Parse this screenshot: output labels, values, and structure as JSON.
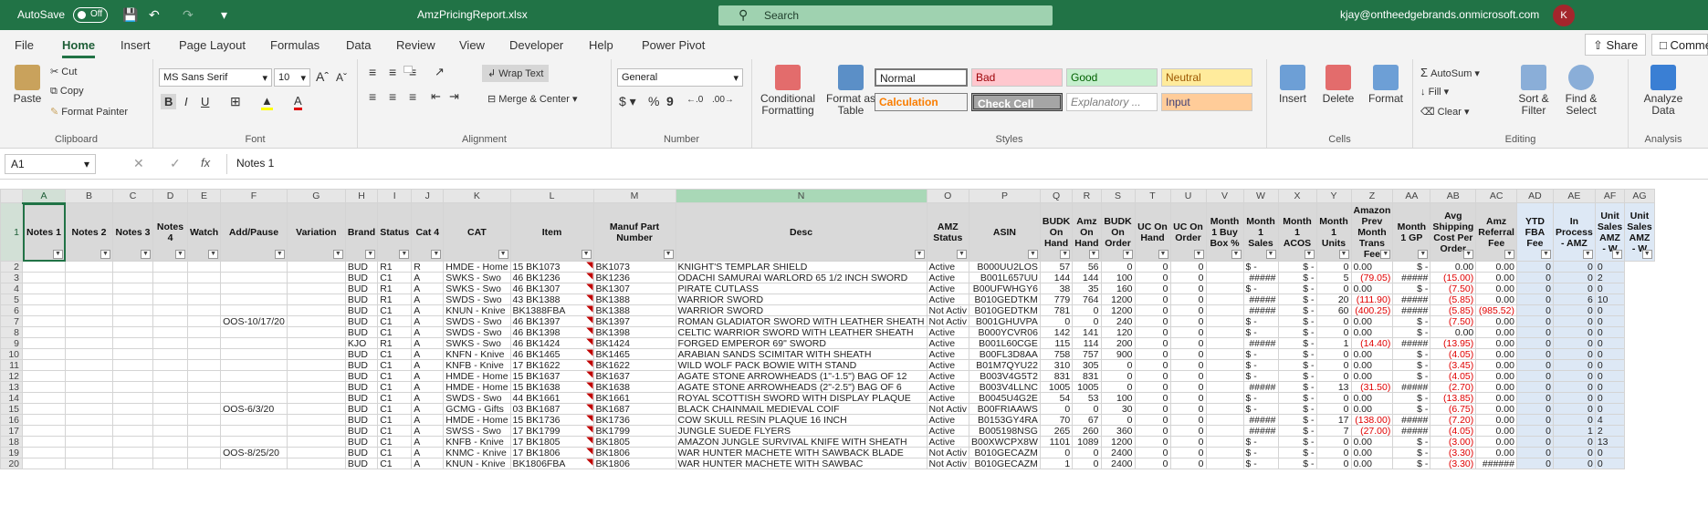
{
  "titlebar": {
    "autosave": "AutoSave",
    "toggle": "Off",
    "filename": "AmzPricingReport.xlsx",
    "search": "Search",
    "user": "kjay@ontheedgebrands.onmicrosoft.com",
    "avatar": "K"
  },
  "tabs": [
    "File",
    "Home",
    "Insert",
    "Page Layout",
    "Formulas",
    "Data",
    "Review",
    "View",
    "Developer",
    "Help",
    "Power Pivot"
  ],
  "share": "Share",
  "comments": "Comme",
  "ribbon": {
    "clipboard": {
      "label": "Clipboard",
      "paste": "Paste",
      "cut": "Cut",
      "copy": "Copy",
      "painter": "Format Painter"
    },
    "font": {
      "label": "Font",
      "name": "MS Sans Serif",
      "size": "10"
    },
    "alignment": {
      "label": "Alignment",
      "wrap": "Wrap Text",
      "merge": "Merge & Center"
    },
    "number": {
      "label": "Number",
      "format": "General"
    },
    "styles": {
      "label": "Styles",
      "cond": "Conditional Formatting",
      "table": "Format as Table",
      "normal": "Normal",
      "bad": "Bad",
      "good": "Good",
      "neutral": "Neutral",
      "calc": "Calculation",
      "check": "Check Cell",
      "explan": "Explanatory ...",
      "input": "Input"
    },
    "cells": {
      "label": "Cells",
      "insert": "Insert",
      "delete": "Delete",
      "format": "Format"
    },
    "editing": {
      "label": "Editing",
      "autosum": "AutoSum",
      "fill": "Fill",
      "clear": "Clear",
      "sort": "Sort & Filter",
      "find": "Find & Select"
    },
    "analysis": {
      "label": "Analysis",
      "analyze": "Analyze Data"
    }
  },
  "formula": {
    "namebox": "A1",
    "content": "Notes 1"
  },
  "columns": [
    "A",
    "B",
    "C",
    "D",
    "E",
    "F",
    "G",
    "H",
    "I",
    "J",
    "K",
    "L",
    "M",
    "N",
    "O",
    "P",
    "Q",
    "R",
    "S",
    "T",
    "U",
    "V",
    "W",
    "X",
    "Y",
    "Z",
    "AA",
    "AB",
    "AC",
    "AD",
    "AE",
    "AF",
    "AG"
  ],
  "headers": [
    "Notes 1",
    "Notes 2",
    "Notes 3",
    "Notes 4",
    "Watch",
    "Add/Pause",
    "Variation",
    "Brand",
    "Status",
    "Cat 4",
    "CAT",
    "Item",
    "Manuf Part Number",
    "Desc",
    "AMZ Status",
    "ASIN",
    "BUDK On Hand",
    "Amz On Hand",
    "BUDK On Order",
    "UC On Hand",
    "UC On Order",
    "Month 1 Buy Box %",
    "Month 1 Sales",
    "Month 1 ACOS",
    "Month 1 Units",
    "Amazon Prev Month Trans Fee",
    "Month 1 GP",
    "Avg Shipping Cost Per Order",
    "Amz Referral Fee",
    "YTD FBA Fee",
    "In Process - AMZ",
    "Unit Sales AMZ - W",
    "Unit Sales AMZ - W"
  ],
  "rows": [
    [
      "2",
      "",
      "",
      "",
      "",
      "",
      "",
      "",
      "BUD",
      "R1",
      "R",
      "HMDE - Home",
      "15 BK1073",
      "BK1073",
      "KNIGHT'S TEMPLAR SHIELD",
      "Active",
      "B000UU2LOS",
      "57",
      "56",
      "0",
      "0",
      "0",
      "",
      "$ -",
      "$ -",
      "0",
      "0.00",
      "$ -",
      "0.00",
      "0.00",
      "0",
      "0",
      "0"
    ],
    [
      "3",
      "",
      "",
      "",
      "",
      "",
      "",
      "",
      "BUD",
      "C1",
      "A",
      "SWKS - Swo",
      "46 BK1236",
      "BK1236",
      "ODACHI SAMURAI WARLORD 65 1/2 INCH SWORD",
      "Active",
      "B001L657UU",
      "144",
      "144",
      "100",
      "0",
      "0",
      "",
      "#####",
      "$ -",
      "5",
      "(79.05)",
      "#####",
      "(15.00)",
      "0.00",
      "0",
      "0",
      "2"
    ],
    [
      "4",
      "",
      "",
      "",
      "",
      "",
      "",
      "",
      "BUD",
      "R1",
      "A",
      "SWKS - Swo",
      "46 BK1307",
      "BK1307",
      "PIRATE CUTLASS",
      "Active",
      "B00UFWHGY6",
      "38",
      "35",
      "160",
      "0",
      "0",
      "",
      "$ -",
      "$ -",
      "0",
      "0.00",
      "$ -",
      "(7.50)",
      "0.00",
      "0",
      "0",
      "0"
    ],
    [
      "5",
      "",
      "",
      "",
      "",
      "",
      "",
      "",
      "BUD",
      "R1",
      "A",
      "SWDS - Swo",
      "43 BK1388",
      "BK1388",
      "WARRIOR SWORD",
      "Active",
      "B010GEDTKM",
      "779",
      "764",
      "1200",
      "0",
      "0",
      "",
      "#####",
      "$ -",
      "20",
      "(111.90)",
      "#####",
      "(5.85)",
      "0.00",
      "0",
      "6",
      "10"
    ],
    [
      "6",
      "",
      "",
      "",
      "",
      "",
      "",
      "",
      "BUD",
      "C1",
      "A",
      "KNUN - Knive",
      "BK1388FBA",
      "BK1388",
      "WARRIOR SWORD",
      "Not Activ",
      "B010GEDTKM",
      "781",
      "0",
      "1200",
      "0",
      "0",
      "",
      "#####",
      "$ -",
      "60",
      "(400.25)",
      "#####",
      "(5.85)",
      "(985.52)",
      "0",
      "0",
      "0"
    ],
    [
      "7",
      "",
      "",
      "",
      "",
      "",
      "OOS-10/17/20",
      "",
      "BUD",
      "C1",
      "A",
      "SWDS - Swo",
      "46 BK1397",
      "BK1397",
      "ROMAN GLADIATOR SWORD WITH LEATHER SHEATH",
      "Not Activ",
      "B001GHUVPA",
      "0",
      "0",
      "240",
      "0",
      "0",
      "",
      "$ -",
      "$ -",
      "0",
      "0.00",
      "$ -",
      "(7.50)",
      "0.00",
      "0",
      "0",
      "0"
    ],
    [
      "8",
      "",
      "",
      "",
      "",
      "",
      "",
      "",
      "BUD",
      "C1",
      "A",
      "SWDS - Swo",
      "46 BK1398",
      "BK1398",
      "CELTIC WARRIOR SWORD WITH LEATHER SHEATH",
      "Active",
      "B000YCVR06",
      "142",
      "141",
      "120",
      "0",
      "0",
      "",
      "$ -",
      "$ -",
      "0",
      "0.00",
      "$ -",
      "0.00",
      "0.00",
      "0",
      "0",
      "0"
    ],
    [
      "9",
      "",
      "",
      "",
      "",
      "",
      "",
      "",
      "KJO",
      "R1",
      "A",
      "SWKS - Swo",
      "46 BK1424",
      "BK1424",
      "FORGED EMPEROR 69\" SWORD",
      "Active",
      "B001L60CGE",
      "115",
      "114",
      "200",
      "0",
      "0",
      "",
      "#####",
      "$ -",
      "1",
      "(14.40)",
      "#####",
      "(13.95)",
      "0.00",
      "0",
      "0",
      "0"
    ],
    [
      "10",
      "",
      "",
      "",
      "",
      "",
      "",
      "",
      "BUD",
      "C1",
      "A",
      "KNFN - Knive",
      "46 BK1465",
      "BK1465",
      "ARABIAN SANDS SCIMITAR WITH SHEATH",
      "Active",
      "B00FL3D8AA",
      "758",
      "757",
      "900",
      "0",
      "0",
      "",
      "$ -",
      "$ -",
      "0",
      "0.00",
      "$ -",
      "(4.05)",
      "0.00",
      "0",
      "0",
      "0"
    ],
    [
      "11",
      "",
      "",
      "",
      "",
      "",
      "",
      "",
      "BUD",
      "C1",
      "A",
      "KNFB - Knive",
      "17 BK1622",
      "BK1622",
      "WILD WOLF PACK BOWIE WITH STAND",
      "Active",
      "B01M7QYU22",
      "310",
      "305",
      "0",
      "0",
      "0",
      "",
      "$ -",
      "$ -",
      "0",
      "0.00",
      "$ -",
      "(3.45)",
      "0.00",
      "0",
      "0",
      "0"
    ],
    [
      "12",
      "",
      "",
      "",
      "",
      "",
      "",
      "",
      "BUD",
      "C1",
      "A",
      "HMDE - Home",
      "15 BK1637",
      "BK1637",
      "AGATE STONE ARROWHEADS (1\"-1.5\") BAG OF 12",
      "Active",
      "B003V4G5T2",
      "831",
      "831",
      "0",
      "0",
      "0",
      "",
      "$ -",
      "$ -",
      "0",
      "0.00",
      "$ -",
      "(4.05)",
      "0.00",
      "0",
      "0",
      "0"
    ],
    [
      "13",
      "",
      "",
      "",
      "",
      "",
      "",
      "",
      "BUD",
      "C1",
      "A",
      "HMDE - Home",
      "15 BK1638",
      "BK1638",
      "AGATE STONE ARROWHEADS (2\"-2.5\") BAG OF 6",
      "Active",
      "B003V4LLNC",
      "1005",
      "1005",
      "0",
      "0",
      "0",
      "",
      "#####",
      "$ -",
      "13",
      "(31.50)",
      "#####",
      "(2.70)",
      "0.00",
      "0",
      "0",
      "0"
    ],
    [
      "14",
      "",
      "",
      "",
      "",
      "",
      "",
      "",
      "BUD",
      "C1",
      "A",
      "SWDS - Swo",
      "44 BK1661",
      "BK1661",
      "ROYAL SCOTTISH SWORD WITH DISPLAY PLAQUE",
      "Active",
      "B0045U4G2E",
      "54",
      "53",
      "100",
      "0",
      "0",
      "",
      "$ -",
      "$ -",
      "0",
      "0.00",
      "$ -",
      "(13.85)",
      "0.00",
      "0",
      "0",
      "0"
    ],
    [
      "15",
      "",
      "",
      "",
      "",
      "",
      "OOS-6/3/20",
      "",
      "BUD",
      "C1",
      "A",
      "GCMG - Gifts",
      "03 BK1687",
      "BK1687",
      "BLACK CHAINMAIL MEDIEVAL COIF",
      "Not Activ",
      "B00FRIAAWS",
      "0",
      "0",
      "30",
      "0",
      "0",
      "",
      "$ -",
      "$ -",
      "0",
      "0.00",
      "$ -",
      "(6.75)",
      "0.00",
      "0",
      "0",
      "0"
    ],
    [
      "16",
      "",
      "",
      "",
      "",
      "",
      "",
      "",
      "BUD",
      "C1",
      "A",
      "HMDE - Home",
      "15 BK1736",
      "BK1736",
      "COW SKULL RESIN PLAQUE 16 INCH",
      "Active",
      "B0153GY4RA",
      "70",
      "67",
      "0",
      "0",
      "0",
      "",
      "#####",
      "$ -",
      "17",
      "(138.00)",
      "#####",
      "(7.20)",
      "0.00",
      "0",
      "0",
      "4"
    ],
    [
      "17",
      "",
      "",
      "",
      "",
      "",
      "",
      "",
      "BUD",
      "C1",
      "A",
      "SWSS - Swo",
      "17 BK1799",
      "BK1799",
      "JUNGLE SUEDE FLYERS",
      "Active",
      "B005198NSG",
      "265",
      "260",
      "360",
      "0",
      "0",
      "",
      "#####",
      "$ -",
      "7",
      "(27.00)",
      "#####",
      "(4.05)",
      "0.00",
      "0",
      "1",
      "2"
    ],
    [
      "18",
      "",
      "",
      "",
      "",
      "",
      "",
      "",
      "BUD",
      "C1",
      "A",
      "KNFB - Knive",
      "17 BK1805",
      "BK1805",
      "AMAZON JUNGLE SURVIVAL KNIFE WITH SHEATH",
      "Active",
      "B00XWCPX8W",
      "1101",
      "1089",
      "1200",
      "0",
      "0",
      "",
      "$ -",
      "$ -",
      "0",
      "0.00",
      "$ -",
      "(3.00)",
      "0.00",
      "0",
      "0",
      "13"
    ],
    [
      "19",
      "",
      "",
      "",
      "",
      "",
      "OOS-8/25/20",
      "",
      "BUD",
      "C1",
      "A",
      "KNMC - Knive",
      "17 BK1806",
      "BK1806",
      "WAR HUNTER MACHETE WITH SAWBACK BLADE",
      "Not Activ",
      "B010GECAZM",
      "0",
      "0",
      "2400",
      "0",
      "0",
      "",
      "$ -",
      "$ -",
      "0",
      "0.00",
      "$ -",
      "(3.30)",
      "0.00",
      "0",
      "0",
      "0"
    ],
    [
      "20",
      "",
      "",
      "",
      "",
      "",
      "",
      "",
      "BUD",
      "C1",
      "A",
      "KNUN - Knive",
      "BK1806FBA",
      "BK1806",
      "WAR HUNTER MACHETE WITH SAWBAC",
      "Not Activ",
      "B010GECAZM",
      "1",
      "0",
      "2400",
      "0",
      "0",
      "",
      "$ -",
      "$ -",
      "0",
      "0.00",
      "$ -",
      "(3.30)",
      "######",
      "0",
      "0",
      "0"
    ]
  ]
}
